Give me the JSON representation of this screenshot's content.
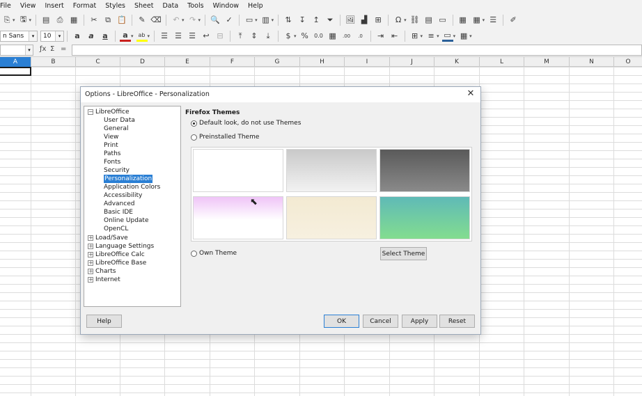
{
  "menubar": {
    "items": [
      "File",
      "View",
      "Insert",
      "Format",
      "Styles",
      "Sheet",
      "Data",
      "Tools",
      "Window",
      "Help"
    ]
  },
  "format_toolbar": {
    "font_name": "Liberation Sans",
    "font_name_visible": "n Sans",
    "font_size": "10"
  },
  "formula_bar": {
    "name_box": "",
    "fx_symbol": "ƒx",
    "sum_symbol": "Σ",
    "equals_symbol": "="
  },
  "sheet": {
    "columns": [
      "A",
      "B",
      "C",
      "D",
      "E",
      "F",
      "G",
      "H",
      "I",
      "J",
      "K",
      "L",
      "M",
      "N",
      "O"
    ],
    "active_column": "A"
  },
  "dialog": {
    "title": "Options - LibreOffice - Personalization",
    "tree": {
      "root": "LibreOffice",
      "children": [
        "User Data",
        "General",
        "View",
        "Print",
        "Paths",
        "Fonts",
        "Security",
        "Personalization",
        "Application Colors",
        "Accessibility",
        "Advanced",
        "Basic IDE",
        "Online Update",
        "OpenCL"
      ],
      "selected": "Personalization",
      "collapsed": [
        "Load/Save",
        "Language Settings",
        "LibreOffice Calc",
        "LibreOffice Base",
        "Charts",
        "Internet"
      ]
    },
    "section_heading": "Firefox Themes",
    "options": {
      "default": "Default look, do not use Themes",
      "preinstalled": "Preinstalled Theme",
      "own": "Own Theme"
    },
    "selected_option": "default",
    "select_theme_button": "Select Theme",
    "buttons": {
      "help": "Help",
      "ok": "OK",
      "cancel": "Cancel",
      "apply": "Apply",
      "reset": "Reset"
    },
    "theme_colors": [
      "#ffffff",
      "#dcdcdc",
      "#707070",
      "#f3d8f7",
      "#f5edd8",
      "#6fcfa0"
    ]
  }
}
